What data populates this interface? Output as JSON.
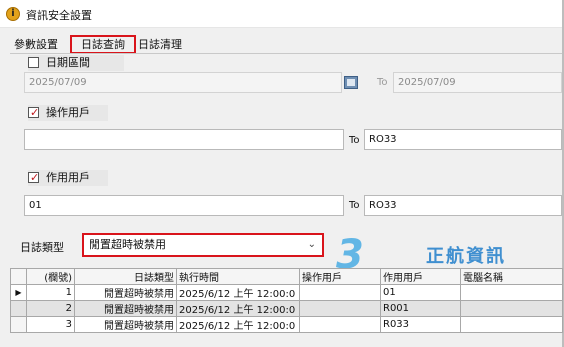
{
  "window": {
    "title": "資訊安全設置"
  },
  "tabs": [
    {
      "label": "參數設置"
    },
    {
      "label": "日誌查詢"
    },
    {
      "label": "日誌清理"
    }
  ],
  "date_range": {
    "label": "日期區間",
    "checked": false,
    "from": "2025/07/09",
    "to_label": "To",
    "to": "2025/07/09"
  },
  "operator_user": {
    "label": "操作用戶",
    "checked": true,
    "from": "",
    "to_label": "To",
    "to": "RO33"
  },
  "target_user": {
    "label": "作用用戶",
    "checked": true,
    "from": "01",
    "to_label": "To",
    "to": "RO33"
  },
  "log_type": {
    "label": "日誌類型",
    "value": "閒置超時被禁用"
  },
  "logo": {
    "text": "正航資訊"
  },
  "table": {
    "columns": [
      "(欄號)",
      "日誌類型",
      "執行時間",
      "操作用戶",
      "作用用戶",
      "電腦名稱"
    ],
    "rows": [
      {
        "no": "1",
        "type": "閒置超時被禁用",
        "time": "2025/6/12 上午 12:00:0",
        "operator": "",
        "target": "01",
        "pc": ""
      },
      {
        "no": "2",
        "type": "閒置超時被禁用",
        "time": "2025/6/12 上午 12:00:0",
        "operator": "",
        "target": "R001",
        "pc": ""
      },
      {
        "no": "3",
        "type": "閒置超時被禁用",
        "time": "2025/6/12 上午 12:00:0",
        "operator": "",
        "target": "R033",
        "pc": ""
      }
    ]
  },
  "colors": {
    "highlight": "#d9141b",
    "check": "#c0181e",
    "logo": "#3f8fd0"
  }
}
